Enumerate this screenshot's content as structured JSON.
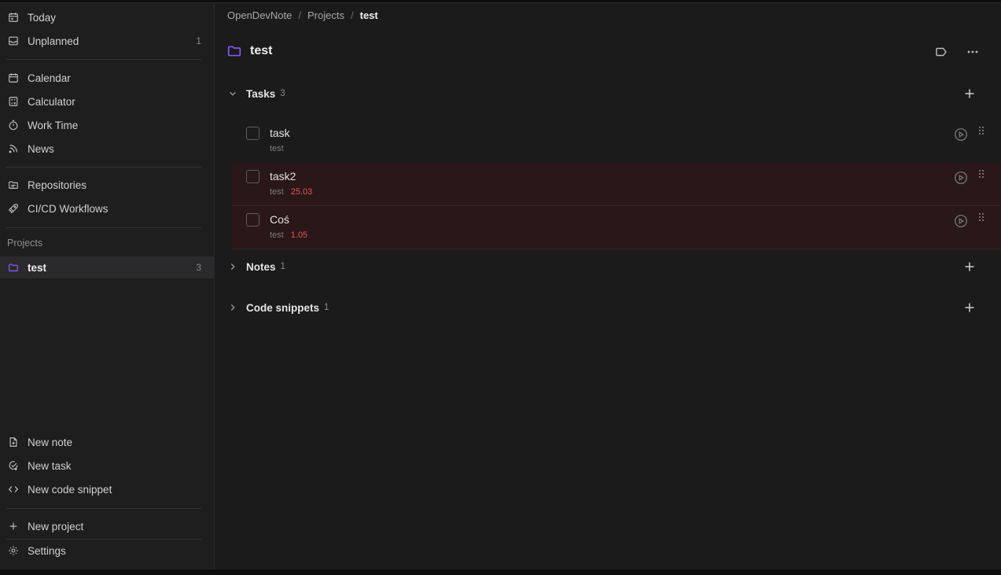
{
  "sidebar": {
    "items": [
      {
        "label": "Today",
        "count": "",
        "icon": "calendar-today-icon"
      },
      {
        "label": "Unplanned",
        "count": "1",
        "icon": "inbox-icon"
      },
      {
        "label": "Calendar",
        "count": "",
        "icon": "calendar-icon"
      },
      {
        "label": "Calculator",
        "count": "",
        "icon": "calculator-icon"
      },
      {
        "label": "Work Time",
        "count": "",
        "icon": "stopwatch-icon"
      },
      {
        "label": "News",
        "count": "",
        "icon": "rss-icon"
      },
      {
        "label": "Repositories",
        "count": "",
        "icon": "folder-repo-icon"
      },
      {
        "label": "CI/CD Workflows",
        "count": "",
        "icon": "rocket-icon"
      }
    ],
    "projects_title": "Projects",
    "projects": [
      {
        "label": "test",
        "count": "3",
        "icon": "folder-icon",
        "color": "#8b5cf6"
      }
    ],
    "actions": [
      {
        "label": "New note",
        "icon": "new-note-icon"
      },
      {
        "label": "New task",
        "icon": "new-task-icon"
      },
      {
        "label": "New code snippet",
        "icon": "code-icon"
      }
    ],
    "new_project": "New project",
    "settings": "Settings"
  },
  "breadcrumb": [
    "OpenDevNote",
    "Projects",
    "test"
  ],
  "page": {
    "title": "test",
    "accent": "#8b5cf6"
  },
  "groups": {
    "tasks": {
      "title": "Tasks",
      "count": "3"
    },
    "notes": {
      "title": "Notes",
      "count": "1"
    },
    "snippets": {
      "title": "Code snippets",
      "count": "1"
    }
  },
  "tasks": [
    {
      "name": "task",
      "project": "test",
      "date": "",
      "overdue": false
    },
    {
      "name": "task2",
      "project": "test",
      "date": "25.03",
      "overdue": true
    },
    {
      "name": "Coś",
      "project": "test",
      "date": "1.05",
      "overdue": true
    }
  ],
  "colors": {
    "overdue_date": "#e25555",
    "overdue_bg": "#2a1717"
  }
}
